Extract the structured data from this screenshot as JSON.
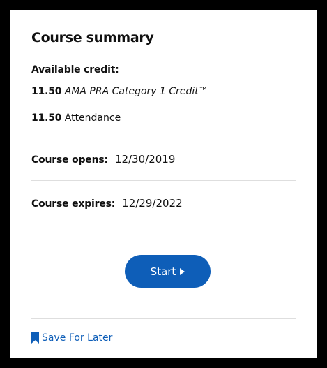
{
  "card": {
    "title": "Course summary",
    "available_credit_label": "Available credit:",
    "credits": [
      {
        "amount": "11.50",
        "type": "AMA PRA Category 1 Credit™"
      },
      {
        "amount": "11.50",
        "type": "Attendance"
      }
    ],
    "opens_label": "Course opens:",
    "opens_date": "12/30/2019",
    "expires_label": "Course expires:",
    "expires_date": "12/29/2022",
    "start_label": "Start",
    "start_icon": "play-triangle-icon",
    "save_label": "Save For Later",
    "save_icon": "bookmark-icon"
  },
  "colors": {
    "accent": "#0e5eb8",
    "frame": "#000000",
    "divider": "#dedede"
  }
}
